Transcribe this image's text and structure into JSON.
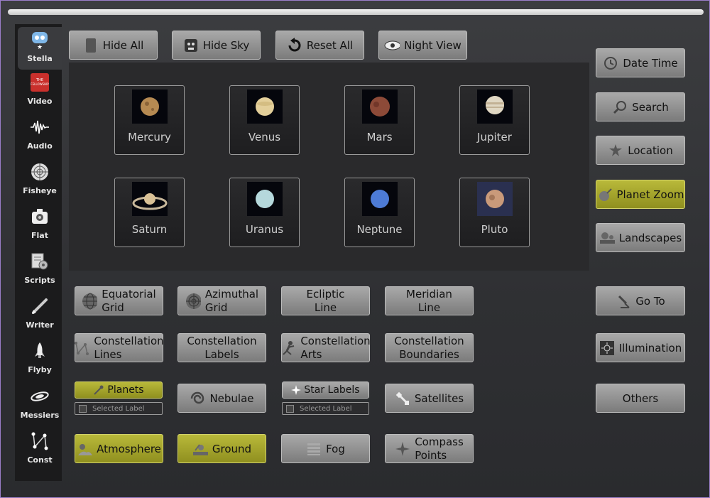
{
  "sidebar": {
    "items": [
      {
        "label": "Stella",
        "icon": "stella-icon"
      },
      {
        "label": "Video",
        "icon": "video-icon"
      },
      {
        "label": "Audio",
        "icon": "audio-waveform-icon"
      },
      {
        "label": "Fisheye",
        "icon": "fisheye-icon"
      },
      {
        "label": "Flat",
        "icon": "flat-camera-icon"
      },
      {
        "label": "Scripts",
        "icon": "scripts-icon"
      },
      {
        "label": "Writer",
        "icon": "pen-icon"
      },
      {
        "label": "Flyby",
        "icon": "rocket-icon"
      },
      {
        "label": "Messiers",
        "icon": "galaxy-icon"
      },
      {
        "label": "Const",
        "icon": "constellation-icon"
      }
    ],
    "video_badge": "THE FELLOWSHIP SHOW"
  },
  "toolbar": {
    "hide_all": "Hide All",
    "hide_sky": "Hide Sky",
    "reset_all": "Reset All",
    "night_view": "Night View"
  },
  "planets": [
    "Mercury",
    "Venus",
    "Mars",
    "Jupiter",
    "Saturn",
    "Uranus",
    "Neptune",
    "Pluto"
  ],
  "right": {
    "date_time": "Date Time",
    "search": "Search",
    "location": "Location",
    "planet_zoom": "Planet Zoom",
    "landscapes": "Landscapes",
    "go_to": "Go To",
    "illumination": "Illumination",
    "others": "Others"
  },
  "grid": {
    "equatorial": [
      "Equatorial",
      "Grid"
    ],
    "azimuthal": [
      "Azimuthal",
      "Grid"
    ],
    "ecliptic": [
      "Ecliptic",
      "Line"
    ],
    "meridian": [
      "Meridian",
      "Line"
    ],
    "const_lines": [
      "Constellation",
      "Lines"
    ],
    "const_labels": [
      "Constellation",
      "Labels"
    ],
    "const_arts": [
      "Constellation",
      "Arts"
    ],
    "const_bounds": [
      "Constellation",
      "Boundaries"
    ],
    "planets": "Planets",
    "planets_sel": "Selected Label",
    "nebulae": "Nebulae",
    "star_labels": "Star Labels",
    "star_sel": "Selected Label",
    "satellites": "Satellites",
    "atmosphere": "Atmosphere",
    "ground": "Ground",
    "fog": "Fog",
    "compass": [
      "Compass",
      "Points"
    ]
  },
  "colors": {
    "active_yellow": "#a8a82e",
    "button_gray": "#9a9a9a"
  }
}
